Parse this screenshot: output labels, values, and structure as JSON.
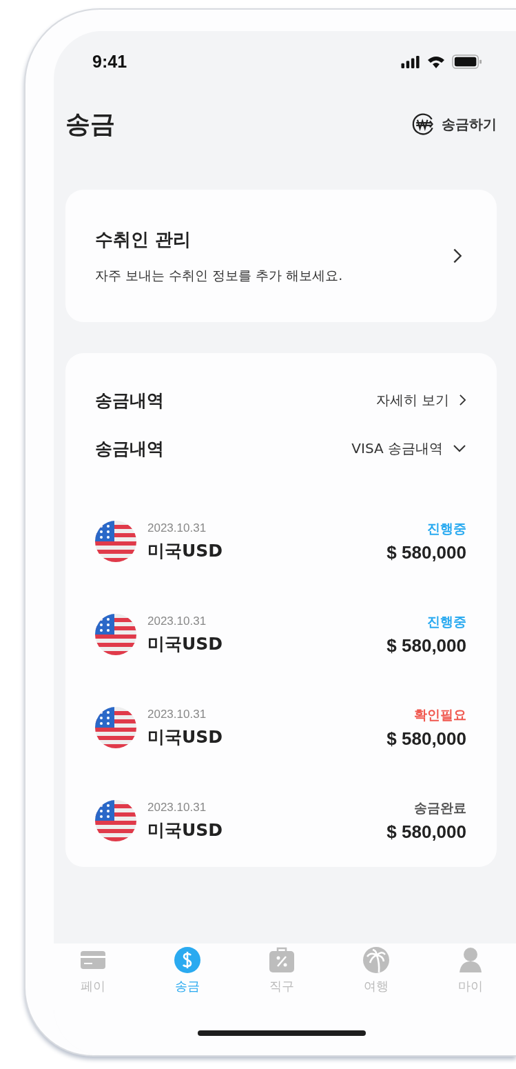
{
  "status_bar": {
    "time": "9:41"
  },
  "header": {
    "title": "송금",
    "action": "송금하기"
  },
  "recipient_card": {
    "title": "수취인 관리",
    "description": "자주 보내는 수취인 정보를 추가 해보세요."
  },
  "history": {
    "title": "송금내역",
    "link": "자세히 보기",
    "filter_label": "송금내역",
    "filter_value": "VISA 송금내역",
    "rows": [
      {
        "date": "2023.10.31",
        "currency": "미국USD",
        "status": "진행중",
        "color": "#2aaaf0",
        "amount": "$ 580,000"
      },
      {
        "date": "2023.10.31",
        "currency": "미국USD",
        "status": "진행중",
        "color": "#2aaaf0",
        "amount": "$ 580,000"
      },
      {
        "date": "2023.10.31",
        "currency": "미국USD",
        "status": "확인필요",
        "color": "#f0584f",
        "amount": "$ 580,000"
      },
      {
        "date": "2023.10.31",
        "currency": "미국USD",
        "status": "송금완료",
        "color": "#555555",
        "amount": "$ 580,000"
      }
    ]
  },
  "tab_bar": [
    {
      "label": "페이",
      "selected": false
    },
    {
      "label": "송금",
      "selected": true
    },
    {
      "label": "직구",
      "selected": false
    },
    {
      "label": "여행",
      "selected": false
    },
    {
      "label": "마이",
      "selected": false
    }
  ]
}
